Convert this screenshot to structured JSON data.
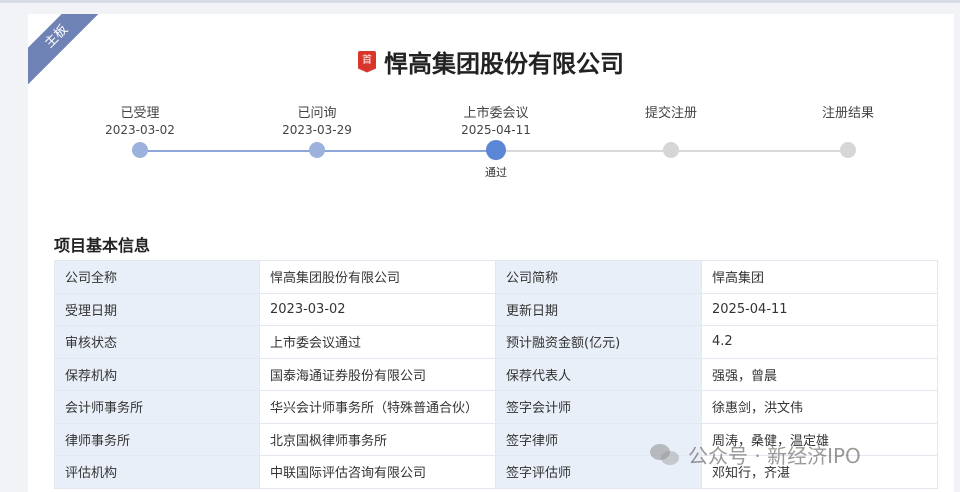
{
  "board_tag": "主板",
  "company": {
    "badge": "首",
    "title": "悍高集团股份有限公司"
  },
  "timeline": {
    "steps": [
      {
        "label": "已受理",
        "date": "2023-03-02",
        "status": "done",
        "result": ""
      },
      {
        "label": "已问询",
        "date": "2023-03-29",
        "status": "done",
        "result": ""
      },
      {
        "label": "上市委会议",
        "date": "2025-04-11",
        "status": "current",
        "result": "通过"
      },
      {
        "label": "提交注册",
        "date": "",
        "status": "pending",
        "result": ""
      },
      {
        "label": "注册结果",
        "date": "",
        "status": "pending",
        "result": ""
      }
    ]
  },
  "section_title": "项目基本信息",
  "info_rows": [
    {
      "k1": "公司全称",
      "v1": "悍高集团股份有限公司",
      "v1_link": false,
      "k2": "公司简称",
      "v2": "悍高集团"
    },
    {
      "k1": "受理日期",
      "v1": "2023-03-02",
      "v1_link": false,
      "k2": "更新日期",
      "v2": "2025-04-11"
    },
    {
      "k1": "审核状态",
      "v1": "上市委会议通过",
      "v1_link": false,
      "k2": "预计融资金额(亿元)",
      "v2": "4.2"
    },
    {
      "k1": "保荐机构",
      "v1": "国泰海通证券股份有限公司",
      "v1_link": true,
      "k2": "保荐代表人",
      "v2": "强强，曾晨"
    },
    {
      "k1": "会计师事务所",
      "v1": "华兴会计师事务所（特殊普通合伙）",
      "v1_link": true,
      "k2": "签字会计师",
      "v2": "徐惠剑，洪文伟"
    },
    {
      "k1": "律师事务所",
      "v1": "北京国枫律师事务所",
      "v1_link": true,
      "k2": "签字律师",
      "v2": "周涛，桑健，温定雄"
    },
    {
      "k1": "评估机构",
      "v1": "中联国际评估咨询有限公司",
      "v1_link": false,
      "k2": "签字评估师",
      "v2": "邓知行，齐湛"
    }
  ],
  "watermark": "公众号 · 新经济IPO",
  "colors": {
    "accent": "#5b86d6",
    "done": "#9cb2dc",
    "pending": "#d6d6d6",
    "link": "#3a78c4",
    "key_bg": "#e9eff8",
    "ribbon": "#6f82b6",
    "badge": "#d9362b"
  }
}
